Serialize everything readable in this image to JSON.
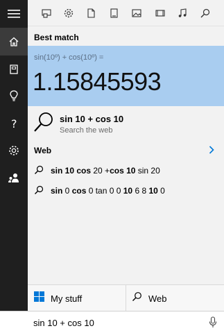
{
  "rail": {
    "icons": [
      "hamburger-menu-icon",
      "home-icon",
      "notebook-icon",
      "lightbulb-icon",
      "help-icon",
      "settings-icon",
      "feedback-icon"
    ]
  },
  "filters": [
    "apps-filter-icon",
    "settings-filter-icon",
    "documents-filter-icon",
    "folders-filter-icon",
    "photos-filter-icon",
    "videos-filter-icon",
    "music-filter-icon",
    "web-filter-icon"
  ],
  "best_match": {
    "label": "Best match",
    "expression": "sin(10º) + cos(10º) =",
    "result": "1.15845593"
  },
  "web_search": {
    "query": "sin 10 + cos 10",
    "subtitle": "Search the web"
  },
  "web": {
    "label": "Web",
    "suggestions": [
      [
        {
          "t": "sin 10 cos",
          "b": true
        },
        {
          "t": " 20 +",
          "b": false
        },
        {
          "t": "cos 10",
          "b": true
        },
        {
          "t": " sin 20",
          "b": false
        }
      ],
      [
        {
          "t": "sin",
          "b": true
        },
        {
          "t": " 0 ",
          "b": false
        },
        {
          "t": "cos",
          "b": true
        },
        {
          "t": " 0 tan 0 0 ",
          "b": false
        },
        {
          "t": "10",
          "b": true
        },
        {
          "t": " 6 8 ",
          "b": false
        },
        {
          "t": "10",
          "b": true
        },
        {
          "t": " 0",
          "b": false
        }
      ]
    ]
  },
  "tabs": {
    "my_stuff": "My stuff",
    "web": "Web"
  },
  "search": {
    "value": "sin 10 + cos 10"
  },
  "colors": {
    "rail": "#1f1f1f",
    "highlight": "#a9cdf0",
    "accent": "#0078d7",
    "windows_logo": "#0078d7"
  }
}
